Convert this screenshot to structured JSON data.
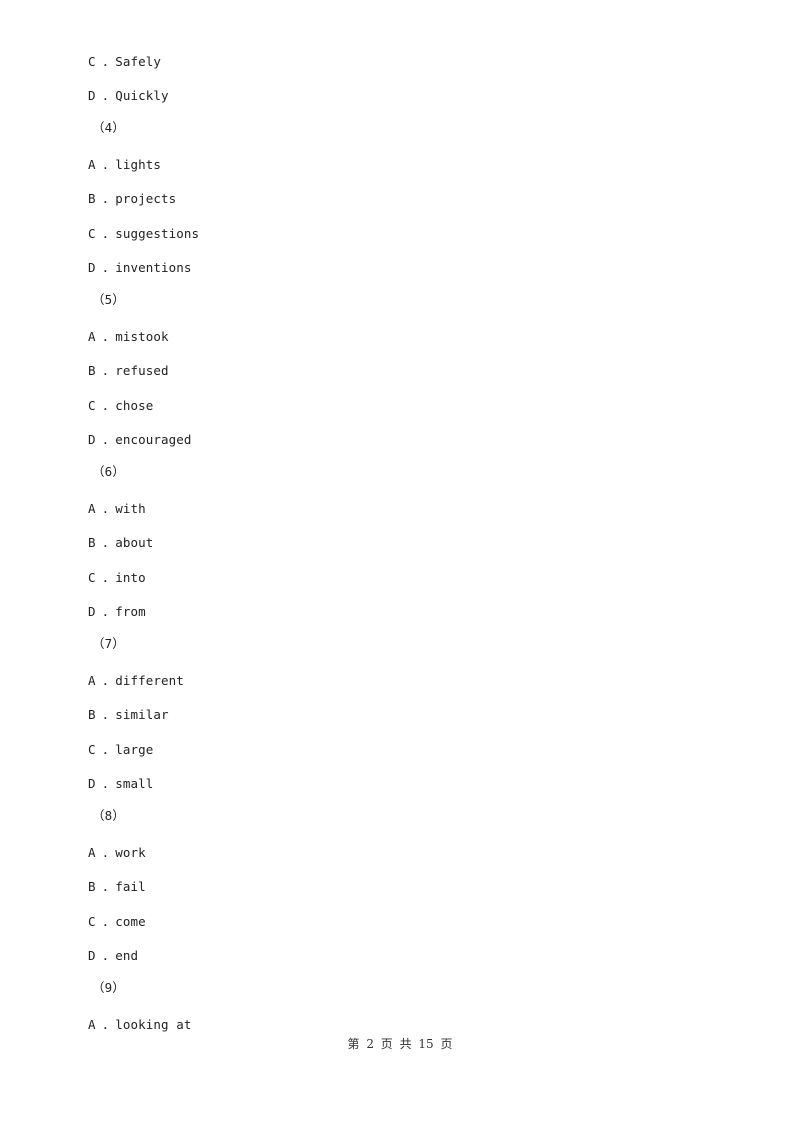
{
  "blocks": [
    {
      "type": "option",
      "letter": "C",
      "text": "Safely"
    },
    {
      "type": "option",
      "letter": "D",
      "text": "Quickly"
    },
    {
      "type": "question",
      "label": "（4）"
    },
    {
      "type": "option",
      "letter": "A",
      "text": "lights"
    },
    {
      "type": "option",
      "letter": "B",
      "text": "projects"
    },
    {
      "type": "option",
      "letter": "C",
      "text": "suggestions"
    },
    {
      "type": "option",
      "letter": "D",
      "text": "inventions"
    },
    {
      "type": "question",
      "label": "（5）"
    },
    {
      "type": "option",
      "letter": "A",
      "text": "mistook"
    },
    {
      "type": "option",
      "letter": "B",
      "text": "refused"
    },
    {
      "type": "option",
      "letter": "C",
      "text": "chose"
    },
    {
      "type": "option",
      "letter": "D",
      "text": "encouraged"
    },
    {
      "type": "question",
      "label": "（6）"
    },
    {
      "type": "option",
      "letter": "A",
      "text": "with"
    },
    {
      "type": "option",
      "letter": "B",
      "text": "about"
    },
    {
      "type": "option",
      "letter": "C",
      "text": "into"
    },
    {
      "type": "option",
      "letter": "D",
      "text": "from"
    },
    {
      "type": "question",
      "label": "（7）"
    },
    {
      "type": "option",
      "letter": "A",
      "text": "different"
    },
    {
      "type": "option",
      "letter": "B",
      "text": "similar"
    },
    {
      "type": "option",
      "letter": "C",
      "text": "large"
    },
    {
      "type": "option",
      "letter": "D",
      "text": "small"
    },
    {
      "type": "question",
      "label": "（8）"
    },
    {
      "type": "option",
      "letter": "A",
      "text": "work"
    },
    {
      "type": "option",
      "letter": "B",
      "text": "fail"
    },
    {
      "type": "option",
      "letter": "C",
      "text": "come"
    },
    {
      "type": "option",
      "letter": "D",
      "text": "end"
    },
    {
      "type": "question",
      "label": "（9）"
    },
    {
      "type": "option",
      "letter": "A",
      "text": "looking at"
    }
  ],
  "footer": {
    "text": "第 2 页 共 15 页"
  }
}
